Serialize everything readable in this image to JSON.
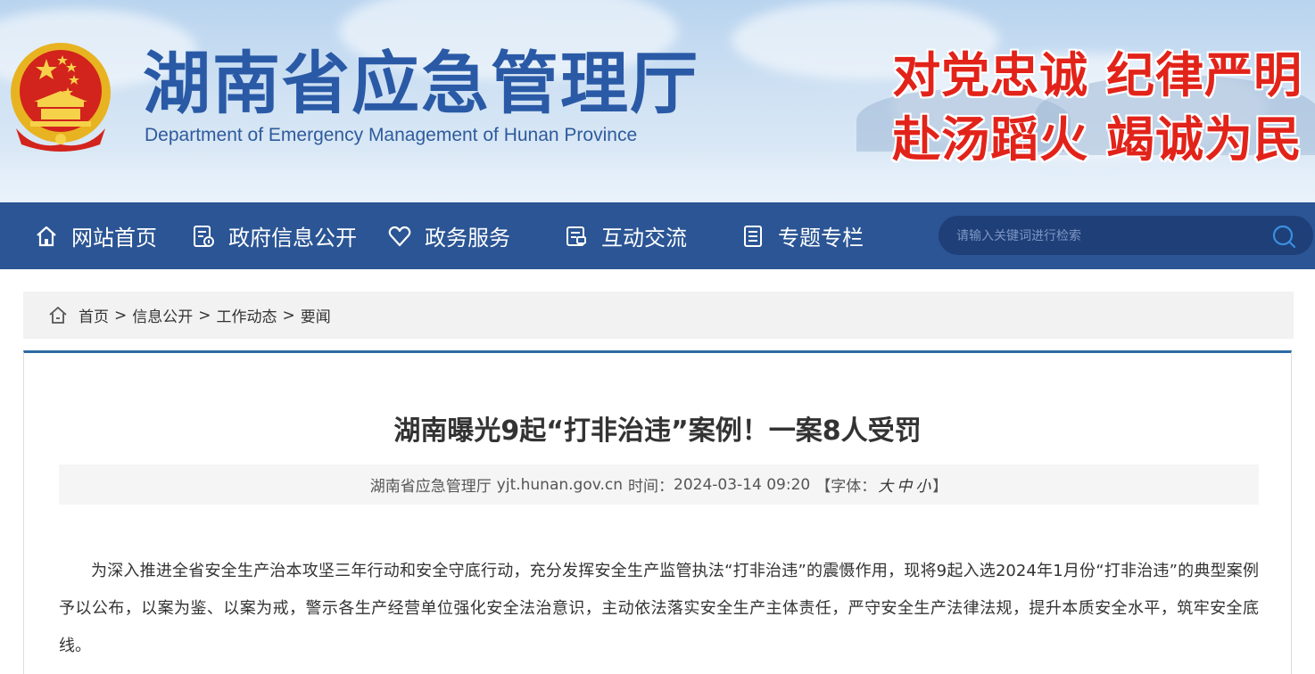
{
  "header": {
    "title_cn": "湖南省应急管理厅",
    "title_en": "Department of Emergency Management of Hunan Province",
    "slogan_line1": "对党忠诚  纪律严明",
    "slogan_line2": "赴汤蹈火  竭诚为民",
    "colors": {
      "banner_text": "#2a5aa6",
      "slogan": "#e2231a"
    }
  },
  "nav": {
    "items": [
      {
        "label": "网站首页",
        "icon": "home-icon"
      },
      {
        "label": "政府信息公开",
        "icon": "document-info-icon"
      },
      {
        "label": "政务服务",
        "icon": "heart-icon"
      },
      {
        "label": "互动交流",
        "icon": "chat-icon"
      },
      {
        "label": "专题专栏",
        "icon": "list-icon"
      }
    ],
    "search_placeholder": "请输入关键词进行检索",
    "color": "#2b5594"
  },
  "breadcrumb": {
    "items": [
      "首页",
      "信息公开",
      "工作动态",
      "要闻"
    ],
    "separator": ">"
  },
  "article": {
    "title": "湖南曝光9起“打非治违”案例！一案8人受罚",
    "source": "湖南省应急管理厅",
    "site": "yjt.hunan.gov.cn",
    "time_label": "时间：",
    "time": "2024-03-14 09:20",
    "font_label_open": "【字体：",
    "font_large": "大",
    "font_medium": "中",
    "font_small": "小",
    "font_label_close": "】",
    "paragraph": "为深入推进全省安全生产治本攻坚三年行动和安全守底行动，充分发挥安全生产监管执法“打非治违”的震慑作用，现将9起入选2024年1月份“打非治违”的典型案例予以公布，以案为鉴、以案为戒，警示各生产经营单位强化安全法治意识，主动依法落实安全生产主体责任，严守安全生产法律法规，提升本质安全水平，筑牢安全底线。"
  }
}
